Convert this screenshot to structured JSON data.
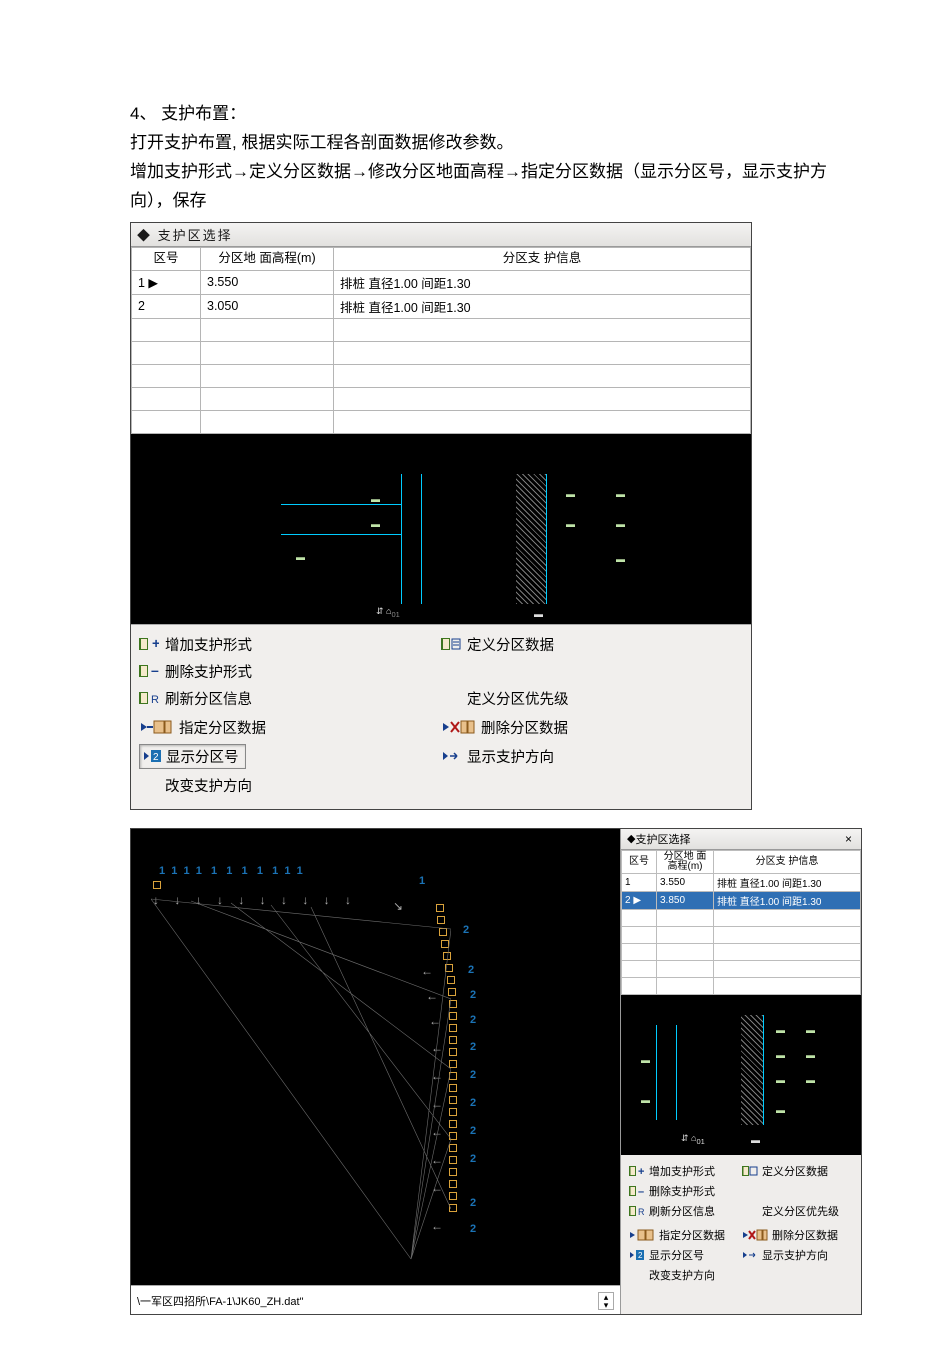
{
  "doc": {
    "heading": "4、 支护布置：",
    "line1": " 打开支护布置, 根据实际工程各剖面数据修改参数。",
    "line2": "增加支护形式→定义分区数据→修改分区地面高程→指定分区数据（显示分区号，显示支护方向），保存"
  },
  "fig1": {
    "panel_title": "支护区选择",
    "columns": {
      "c1": "区号",
      "c2": "分区地\n面高程(m)",
      "c3": "分区支\n护信息"
    },
    "rows": [
      {
        "zone": "1 ▶",
        "elev": "3.550",
        "info": "排桩  直径1.00  间距1.30"
      },
      {
        "zone": "2",
        "elev": "3.050",
        "info": "排桩  直径1.00  间距1.30"
      }
    ],
    "actions": {
      "add_form": "增加支护形式",
      "del_form": "删除支护形式",
      "refresh_zone": "刷新分区信息",
      "def_zone": "定义分区数据",
      "def_priority": "定义分区优先级",
      "assign_zone": "指定分区数据",
      "del_zone": "删除分区数据",
      "show_zone_no": "显示分区号",
      "show_dir": "显示支护方向",
      "change_dir": "改变支护方向"
    }
  },
  "fig2": {
    "status_path": "\\一军区四招所\\FA-1\\JK60_ZH.dat\"",
    "panel_title": "支护区选择",
    "columns": {
      "c1": "区号",
      "c2": "分区地\n面高程(m)",
      "c3": "分区支\n护信息"
    },
    "rows": [
      {
        "zone": "1",
        "elev": "3.550",
        "info": "排桩 直径1.00 间距1.30"
      },
      {
        "zone": "2 ▶",
        "elev": "3.850",
        "info": "排桩 直径1.00 间距1.30"
      }
    ],
    "actions": {
      "add_form": "增加支护形式",
      "del_form": "删除支护形式",
      "refresh_zone": "刷新分区信息",
      "def_zone": "定义分区数据",
      "def_priority": "定义分区优先级",
      "assign_zone": "指定分区数据",
      "del_zone": "删除分区数据",
      "show_zone_no": "显示分区号",
      "show_dir": "显示支护方向",
      "change_dir": "改变支护方向"
    }
  }
}
